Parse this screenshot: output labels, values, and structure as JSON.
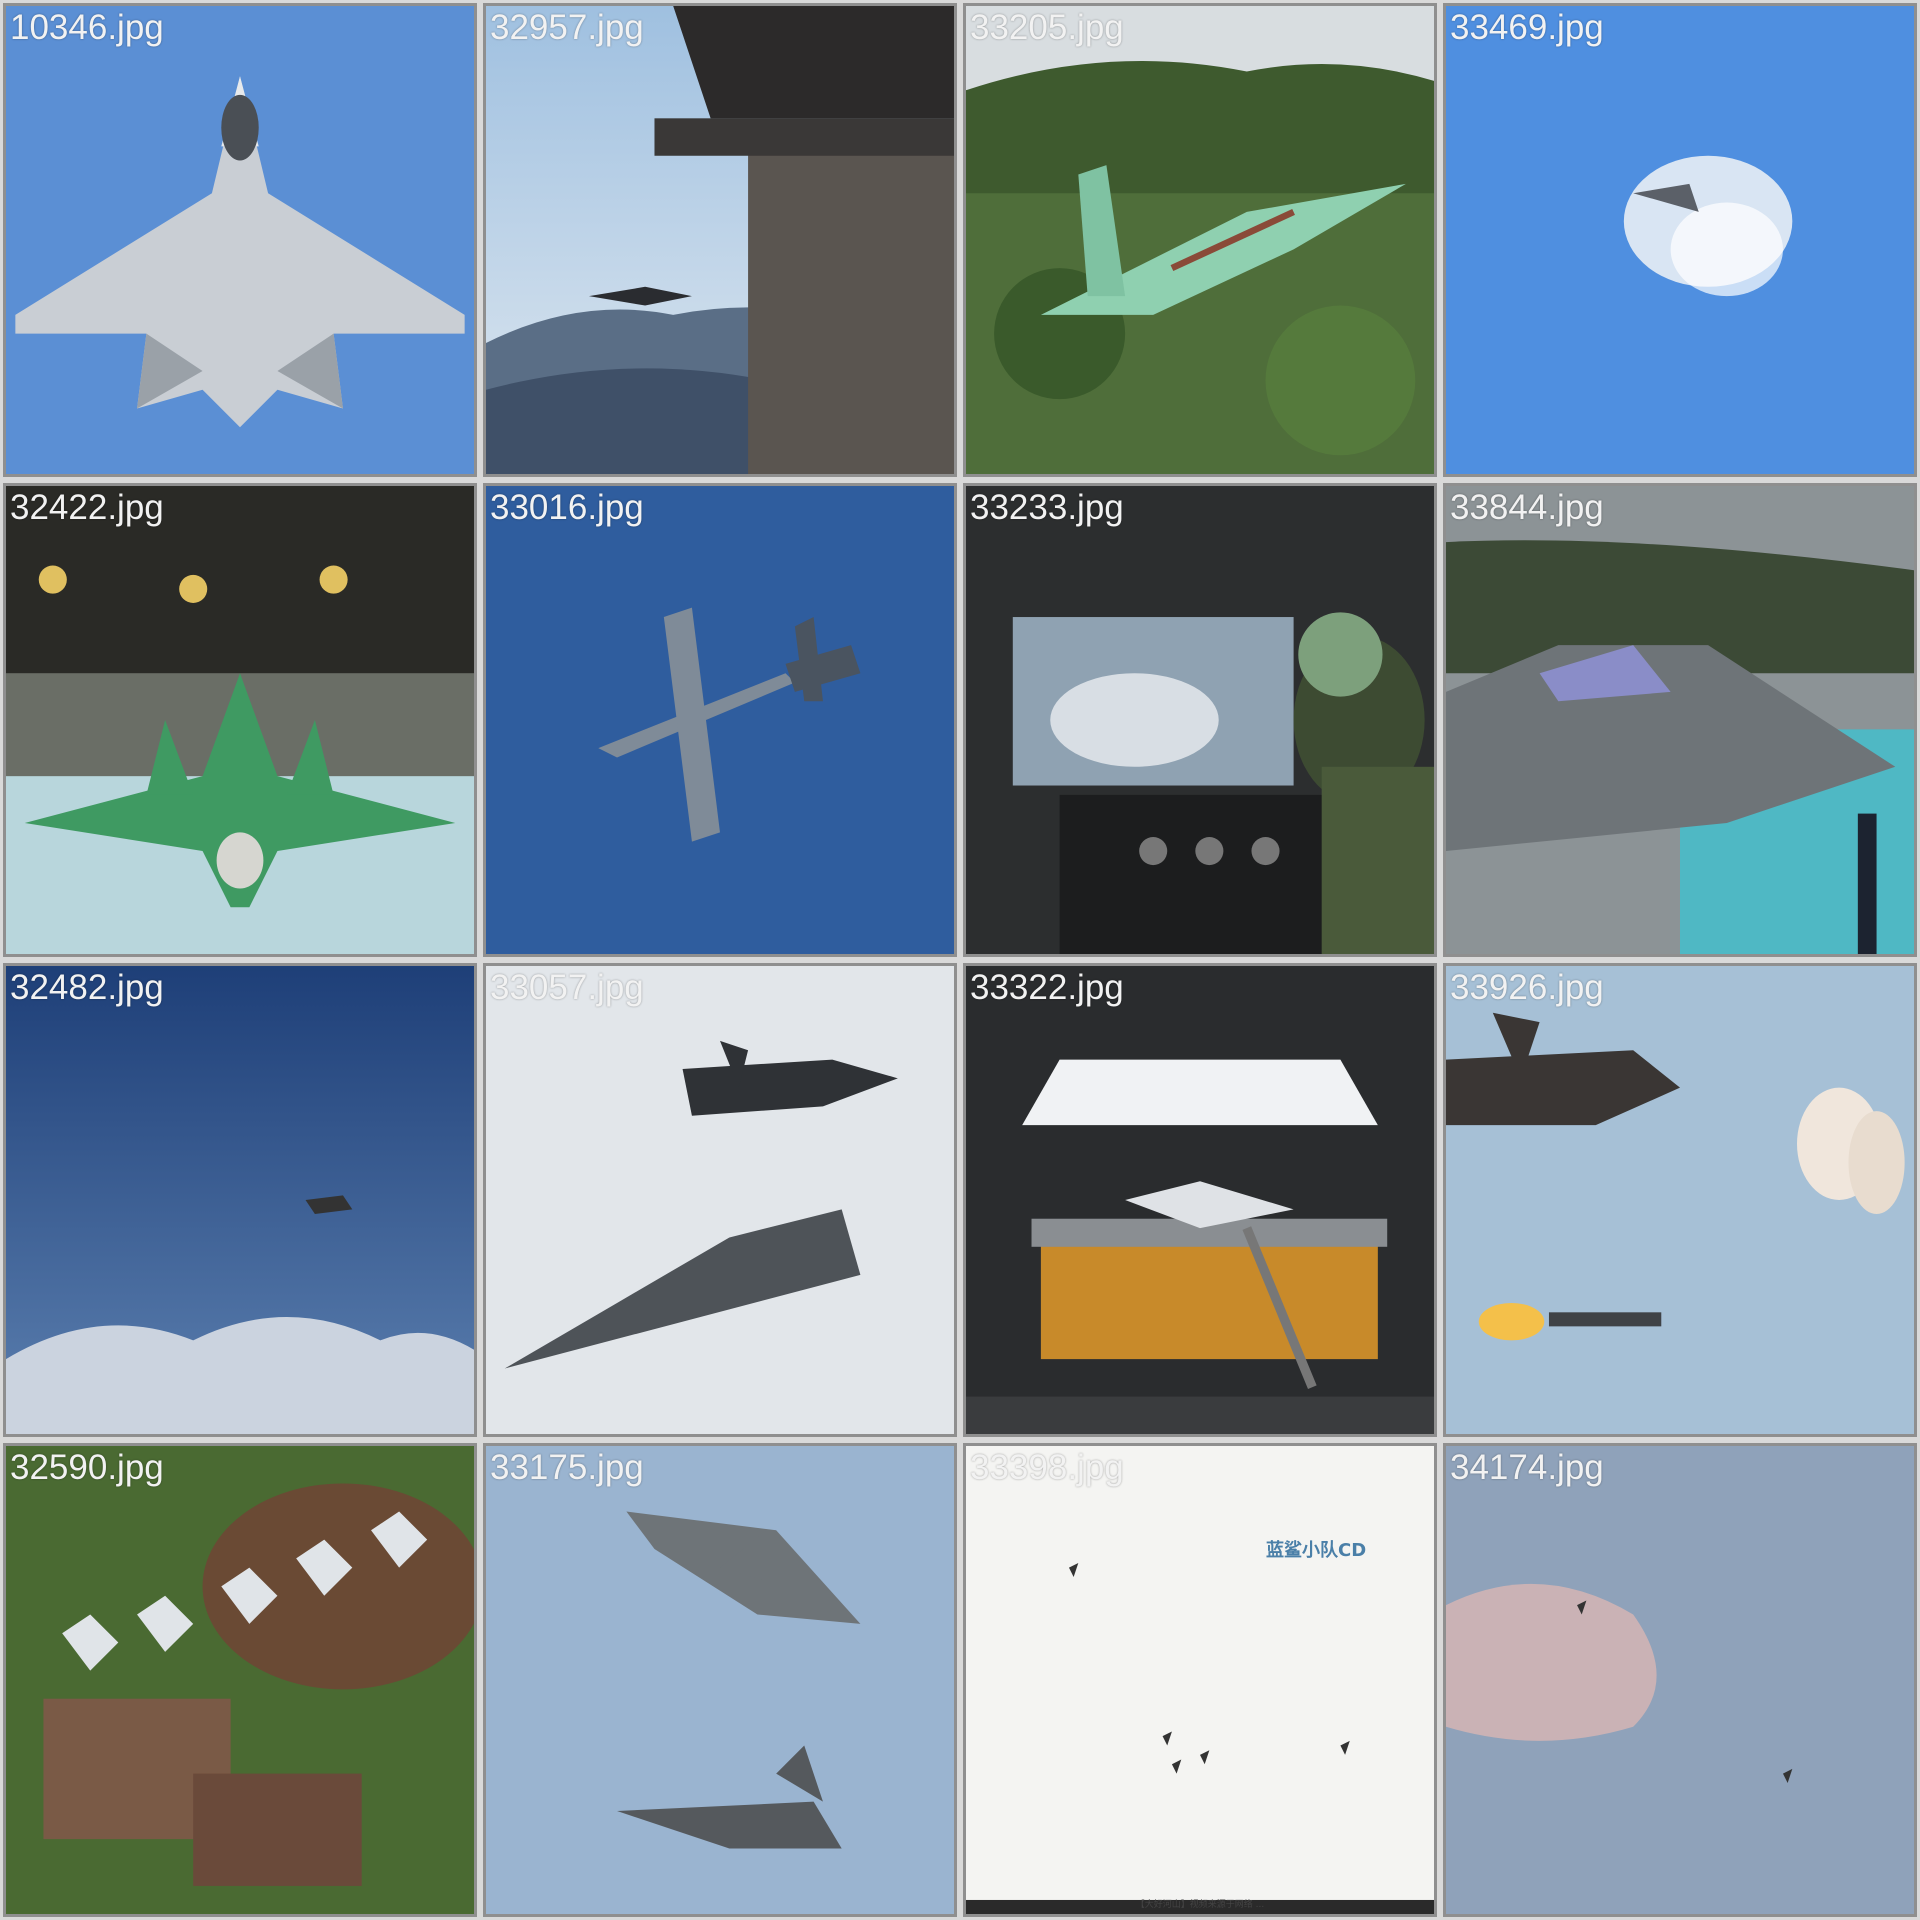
{
  "tiles": [
    {
      "label": "10346.jpg",
      "scene": "f22-topdown-blue-sky"
    },
    {
      "label": "32957.jpg",
      "scene": "f22-past-control-tower"
    },
    {
      "label": "33205.jpg",
      "scene": "green-primer-f22-over-forest"
    },
    {
      "label": "33469.jpg",
      "scene": "vapor-cone-blue-sky"
    },
    {
      "label": "32422.jpg",
      "scene": "green-f22-in-factory"
    },
    {
      "label": "33016.jpg",
      "scene": "tanker-and-fighter-refuel"
    },
    {
      "label": "33233.jpg",
      "scene": "boom-operator-cockpit"
    },
    {
      "label": "33844.jpg",
      "scene": "stealth-fighter-closeup"
    },
    {
      "label": "32482.jpg",
      "scene": "f35-over-clouds"
    },
    {
      "label": "33057.jpg",
      "scene": "f35-and-b2-formation"
    },
    {
      "label": "33322.jpg",
      "scene": "aircraft-in-test-rig"
    },
    {
      "label": "33926.jpg",
      "scene": "f35-with-garlic-and-missile"
    },
    {
      "label": "32590.jpg",
      "scene": "f22-formation-over-estate"
    },
    {
      "label": "33175.jpg",
      "scene": "j20-pair-blue-sky"
    },
    {
      "label": "33398.jpg",
      "scene": "formation-specks-white-sky",
      "logo_text": "蓝鲨小队CD",
      "caption": "【大好河山】视频来源于网络 ..."
    },
    {
      "label": "34174.jpg",
      "scene": "distant-aircraft-hazy-sky"
    }
  ],
  "colors": {
    "border": "#8f8f8f",
    "label_text": "#f2f2f2",
    "background": "#d9d9d9"
  }
}
